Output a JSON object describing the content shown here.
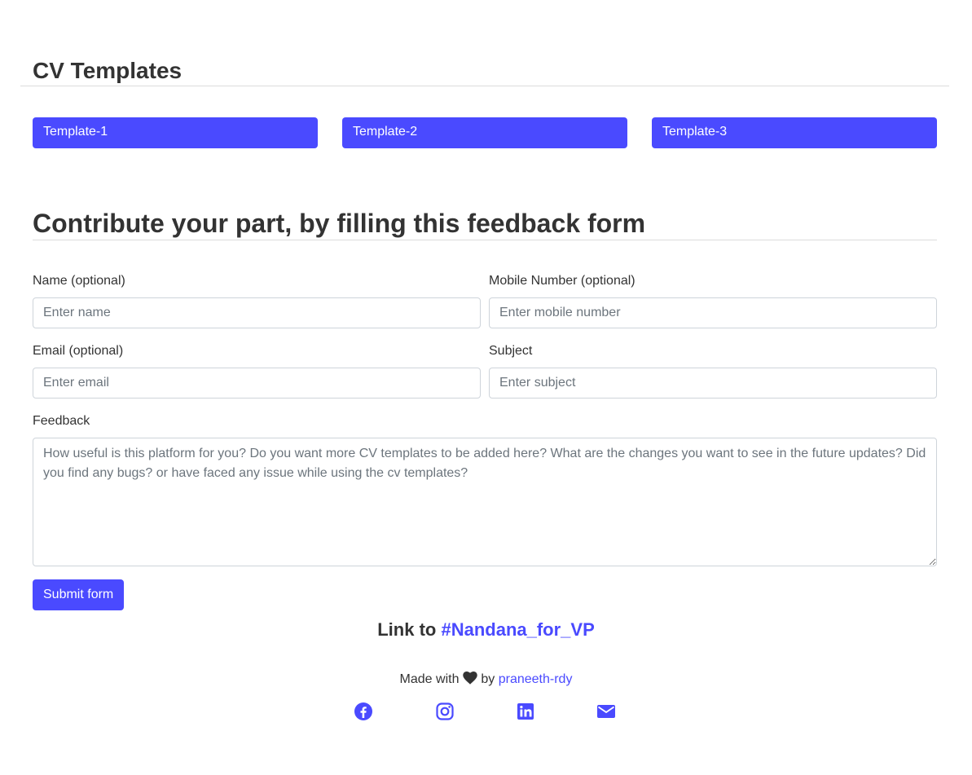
{
  "cv_section": {
    "title": "CV Templates",
    "templates": [
      {
        "label": "Template-1"
      },
      {
        "label": "Template-2"
      },
      {
        "label": "Template-3"
      }
    ]
  },
  "feedback_section": {
    "title": "Contribute your part, by filling this feedback form",
    "fields": {
      "name": {
        "label": "Name (optional)",
        "placeholder": "Enter name",
        "value": ""
      },
      "mobile": {
        "label": "Mobile Number (optional)",
        "placeholder": "Enter mobile number",
        "value": ""
      },
      "email": {
        "label": "Email (optional)",
        "placeholder": "Enter email",
        "value": ""
      },
      "subject": {
        "label": "Subject",
        "placeholder": "Enter subject",
        "value": ""
      },
      "feedback": {
        "label": "Feedback",
        "placeholder": "How useful is this platform for you? Do you want more CV templates to be added here? What are the changes you want to see in the future updates? Did you find any bugs? or have faced any issue while using the cv templates?",
        "value": ""
      }
    },
    "submit_label": "Submit form"
  },
  "link_line": {
    "prefix": "Link to",
    "link_text": "#Nandana_for_VP"
  },
  "footer": {
    "made_with": "Made with",
    "by": "by",
    "author": "praneeth-rdy",
    "social_icons": [
      "facebook-icon",
      "instagram-icon",
      "linkedin-icon",
      "mail-icon"
    ]
  },
  "colors": {
    "accent": "#4a4aff",
    "text": "#333333",
    "rule": "#dcdcdc"
  }
}
